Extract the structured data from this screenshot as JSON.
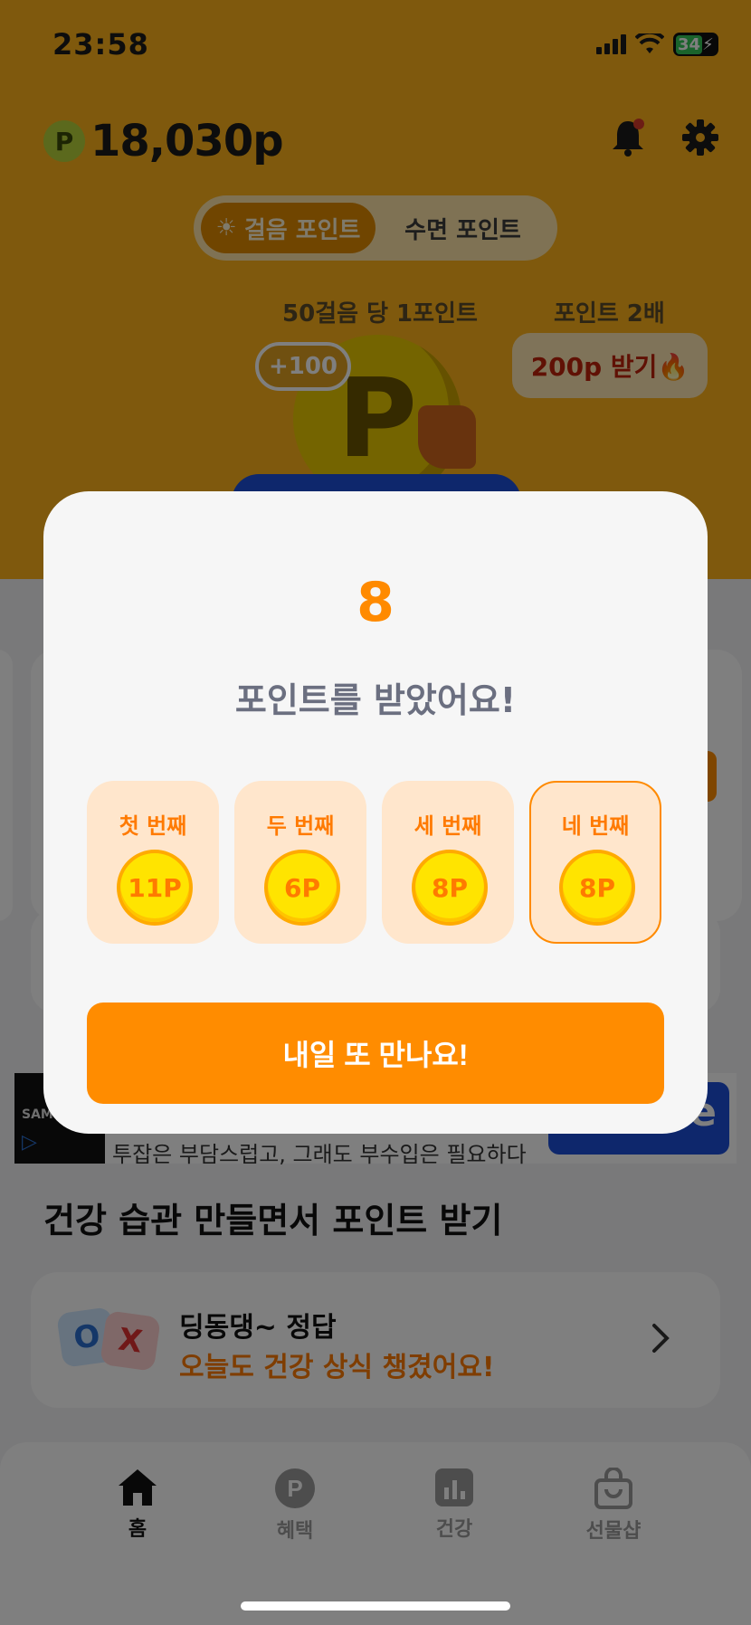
{
  "status_bar": {
    "time": "23:58",
    "battery": "34"
  },
  "header": {
    "points": "18,030p",
    "coin_letter": "P"
  },
  "segment": {
    "walk_label": "걸음 포인트",
    "sleep_label": "수면 포인트",
    "walk_icon": "☀"
  },
  "hero": {
    "steps_rule": "50걸음 당 1포인트",
    "double_label": "포인트 2배",
    "plus_badge": "+100",
    "double_button": "200p 받기🔥",
    "coin_letter": "P"
  },
  "ad": {
    "brand": "SAMS",
    "text": "투잡은 부담스럽고, 그래도 부수입은 필요하다",
    "cta_partial": "e"
  },
  "section": {
    "title": "건강 습관 만들면서 포인트 받기"
  },
  "quiz": {
    "o": "O",
    "x": "X",
    "line1": "딩동댕~ 정답",
    "line2": "오늘도 건강 상식 챙겼어요!"
  },
  "tabs": [
    {
      "label": "홈",
      "icon": "home-icon"
    },
    {
      "label": "혜택",
      "icon": "benefit-p-icon"
    },
    {
      "label": "건강",
      "icon": "chart-icon"
    },
    {
      "label": "선물샵",
      "icon": "shopping-bag-icon"
    }
  ],
  "modal": {
    "points": "8",
    "message": "포인트를 받았어요!",
    "days": [
      {
        "label": "첫 번째",
        "points": "11P"
      },
      {
        "label": "두 번째",
        "points": "6P"
      },
      {
        "label": "세 번째",
        "points": "8P"
      },
      {
        "label": "네 번째",
        "points": "8P"
      }
    ],
    "button": "내일 또 만나요!"
  },
  "colors": {
    "accent": "#ff8c00",
    "brand_yellow": "#ffb21a",
    "coin": "#ffe400"
  }
}
